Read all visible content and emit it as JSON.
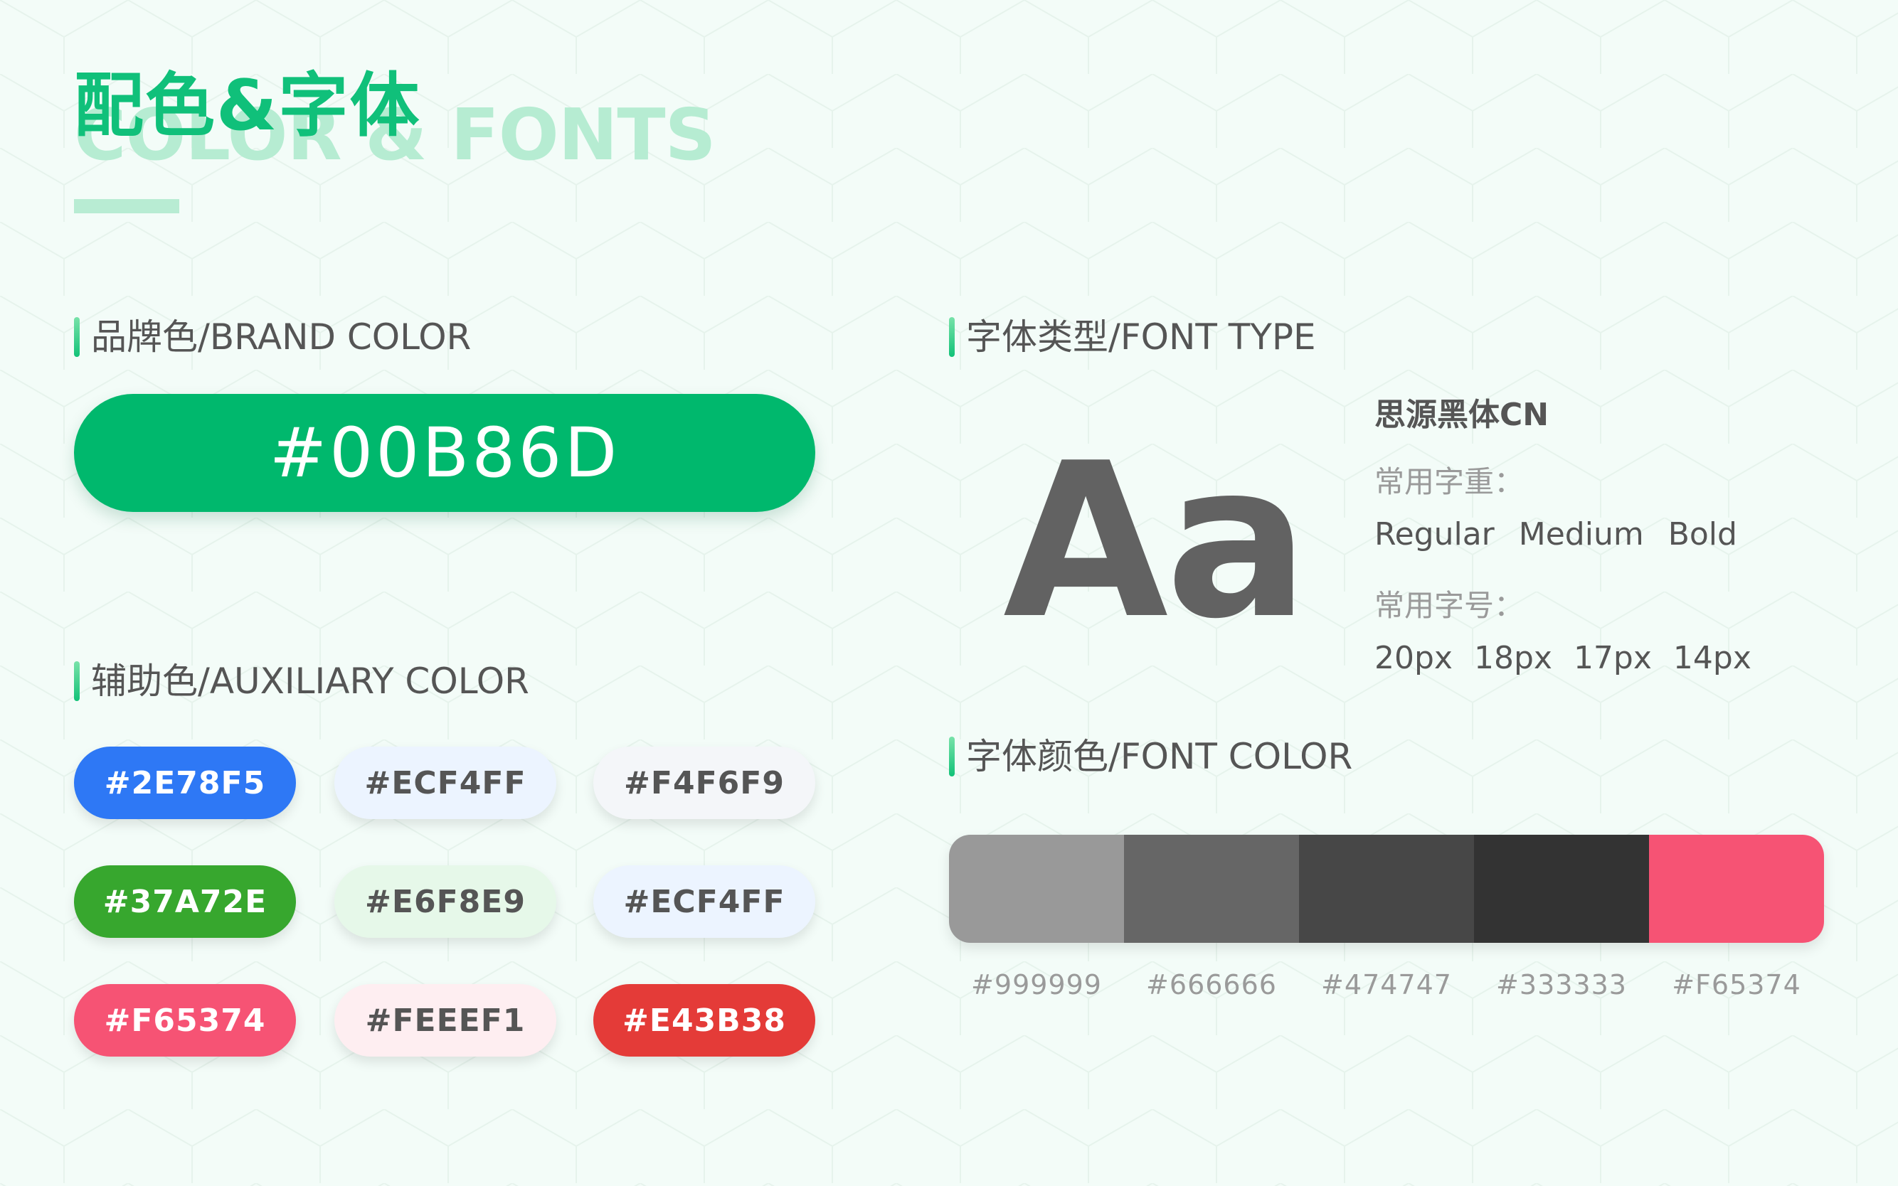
{
  "heading": {
    "title_cn": "配色&字体",
    "title_en": "COLOR & FONTS"
  },
  "brand": {
    "section_title": "品牌色/BRAND COLOR",
    "color_label": "#00B86D",
    "color": "#00B86D"
  },
  "auxiliary": {
    "section_title": "辅助色/AUXILIARY COLOR",
    "swatches": [
      {
        "label": "#2E78F5",
        "color": "#2E78F5",
        "text_color": "#FFFFFF"
      },
      {
        "label": "#ECF4FF",
        "color": "#ECF4FF",
        "text_color": "#555555"
      },
      {
        "label": "#F4F6F9",
        "color": "#F4F6F9",
        "text_color": "#555555"
      },
      {
        "label": "#37A72E",
        "color": "#37A72E",
        "text_color": "#FFFFFF"
      },
      {
        "label": "#E6F8E9",
        "color": "#E6F8E9",
        "text_color": "#555555"
      },
      {
        "label": "#ECF4FF",
        "color": "#ECF4FF",
        "text_color": "#555555"
      },
      {
        "label": "#F65374",
        "color": "#F65374",
        "text_color": "#FFFFFF"
      },
      {
        "label": "#FEEEF1",
        "color": "#FEEEF1",
        "text_color": "#555555"
      },
      {
        "label": "#E43B38",
        "color": "#E43B38",
        "text_color": "#FFFFFF"
      }
    ]
  },
  "font_type": {
    "section_title": "字体类型/FONT TYPE",
    "sample": "Aa",
    "font_name": "思源黑体CN",
    "weights_label": "常用字重：",
    "weights": [
      "Regular",
      "Medium",
      "Bold"
    ],
    "sizes_label": "常用字号：",
    "sizes": [
      "20px",
      "18px",
      "17px",
      "14px"
    ]
  },
  "font_color": {
    "section_title": "字体颜色/FONT COLOR",
    "swatches": [
      {
        "label": "#999999",
        "color": "#999999"
      },
      {
        "label": "#666666",
        "color": "#666666"
      },
      {
        "label": "#474747",
        "color": "#474747"
      },
      {
        "label": "#333333",
        "color": "#333333"
      },
      {
        "label": "#F65374",
        "color": "#F65374"
      }
    ]
  }
}
